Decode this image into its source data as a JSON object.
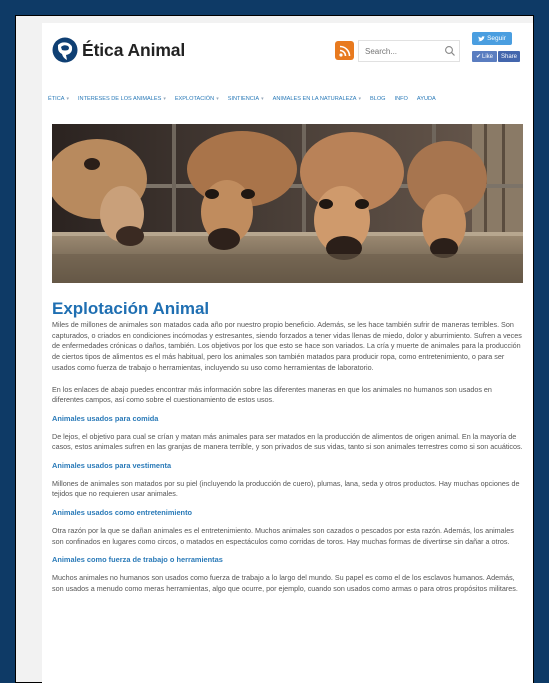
{
  "header": {
    "logo_text": "Ética Animal",
    "search_placeholder": "Search...",
    "twitter_follow": "Seguir",
    "fb_like": "Like",
    "fb_share": "Share"
  },
  "nav": [
    {
      "label": "Ética",
      "caret": true
    },
    {
      "label": "Intereses de los animales",
      "caret": true
    },
    {
      "label": "Explotación",
      "caret": true
    },
    {
      "label": "Sintiencia",
      "caret": true
    },
    {
      "label": "Animales en la naturaleza",
      "caret": true
    },
    {
      "label": "Blog",
      "caret": false
    },
    {
      "label": "Info",
      "caret": false
    },
    {
      "label": "Ayuda",
      "caret": false
    }
  ],
  "article": {
    "title": "Explotación Animal",
    "intro1": "Miles de millones de animales son matados cada año por nuestro propio beneficio. Además, se les hace también sufrir de maneras terribles. Son capturados, o criados en condiciones incómodas y estresantes, siendo forzados a tener vidas llenas de miedo, dolor y aburrimiento. Sufren a veces de enfermedades crónicas o daños, también. Los objetivos por los que esto se hace son variados. La cría y muerte de animales para la producción de ciertos tipos de alimentos es el más habitual, pero los animales son también matados para producir ropa, como entretenimiento, o para ser usados como fuerza de trabajo o herramientas, incluyendo su uso como herramientas de laboratorio.",
    "intro2": "En los enlaces de abajo puedes encontrar más información sobre las diferentes maneras en que los animales no humanos son usados en diferentes campos, así como sobre el cuestionamiento de estos usos.",
    "sections": [
      {
        "heading": "Animales usados para comida",
        "text": "De lejos, el objetivo para cual se crían y matan más animales para ser matados en la producción de alimentos de origen animal. En la mayoría de casos, estos animales sufren en las granjas de manera terrible, y son privados de sus vidas, tanto si son animales terrestres como si son acuáticos."
      },
      {
        "heading": "Animales usados para vestimenta",
        "text": "Millones de animales son matados por su piel (incluyendo la producción de cuero), plumas, lana, seda y otros productos. Hay muchas opciones de tejidos que no requieren usar animales."
      },
      {
        "heading": "Animales usados como entretenimiento",
        "text": "Otra razón por la que se dañan animales es el entretenimiento. Muchos animales son cazados o pescados por esta razón. Además, los animales son confinados en lugares como circos, o matados en espectáculos como corridas de toros. Hay muchas formas de divertirse sin dañar a otros."
      },
      {
        "heading": "Animales como fuerza de trabajo o herramientas",
        "text": "Muchos animales no humanos son usados como fuerza de trabajo a lo largo del mundo. Su papel es como el de los esclavos humanos. Además, son usados a menudo como meras herramientas, algo que ocurre, por ejemplo, cuando son usados como armas o para otros propósitos militares."
      }
    ]
  }
}
